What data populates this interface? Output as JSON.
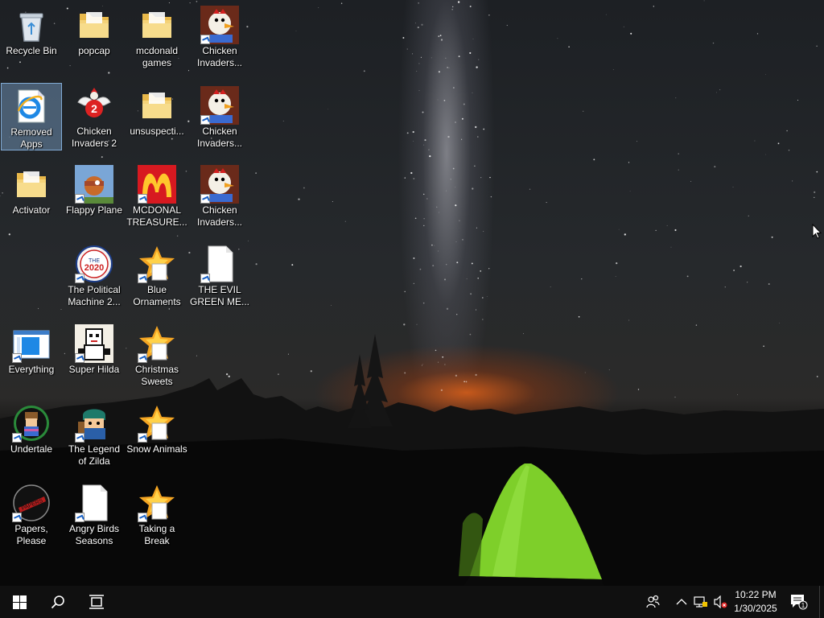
{
  "desktop_icons": [
    {
      "id": "recycle-bin",
      "label": "Recycle Bin",
      "icon": "recycle-bin-icon",
      "shortcut": false,
      "selected": false
    },
    {
      "id": "popcap",
      "label": "popcap",
      "icon": "folder-icon",
      "shortcut": false,
      "selected": false
    },
    {
      "id": "mcdonald-games",
      "label": "mcdonald games",
      "icon": "folder-icon",
      "shortcut": false,
      "selected": false
    },
    {
      "id": "chicken-invaders-1",
      "label": "Chicken Invaders...",
      "icon": "chicken-invaders-icon",
      "shortcut": true,
      "selected": false
    },
    {
      "id": "removed-apps",
      "label": "Removed Apps",
      "icon": "internet-explorer-icon",
      "shortcut": false,
      "selected": true
    },
    {
      "id": "chicken-invaders-2",
      "label": "Chicken Invaders 2",
      "icon": "chicken-invaders-2-icon",
      "shortcut": false,
      "selected": false
    },
    {
      "id": "unsuspecting",
      "label": "unsuspecti...",
      "icon": "folder-icon",
      "shortcut": false,
      "selected": false
    },
    {
      "id": "chicken-invaders-3",
      "label": "Chicken Invaders...",
      "icon": "chicken-invaders-icon",
      "shortcut": true,
      "selected": false
    },
    {
      "id": "activator",
      "label": "Activator",
      "icon": "folder-icon",
      "shortcut": false,
      "selected": false
    },
    {
      "id": "flappy-plane",
      "label": "Flappy Plane",
      "icon": "flappy-plane-icon",
      "shortcut": true,
      "selected": false
    },
    {
      "id": "mcdonal-treasure",
      "label": "MCDONAL TREASURE...",
      "icon": "mcdonalds-icon",
      "shortcut": true,
      "selected": false
    },
    {
      "id": "chicken-invaders-4",
      "label": "Chicken Invaders...",
      "icon": "chicken-invaders-icon",
      "shortcut": true,
      "selected": false
    },
    {
      "id": "political-machine",
      "label": "The Political Machine 2...",
      "icon": "political-machine-icon",
      "shortcut": true,
      "selected": false
    },
    {
      "id": "blue-ornaments",
      "label": "Blue Ornaments",
      "icon": "star-game-icon",
      "shortcut": true,
      "selected": false
    },
    {
      "id": "evil-green-me",
      "label": "THE EVIL GREEN ME...",
      "icon": "blank-file-icon",
      "shortcut": true,
      "selected": false
    },
    {
      "id": "everything",
      "label": "Everything",
      "icon": "everything-search-icon",
      "shortcut": true,
      "selected": false
    },
    {
      "id": "super-hilda",
      "label": "Super Hilda",
      "icon": "super-hilda-icon",
      "shortcut": true,
      "selected": false
    },
    {
      "id": "christmas-sweets",
      "label": "Christmas Sweets",
      "icon": "star-game-icon",
      "shortcut": true,
      "selected": false
    },
    {
      "id": "undertale",
      "label": "Undertale",
      "icon": "undertale-icon",
      "shortcut": true,
      "selected": false
    },
    {
      "id": "legend-of-zilda",
      "label": "The Legend of Zilda",
      "icon": "legend-of-zilda-icon",
      "shortcut": true,
      "selected": false
    },
    {
      "id": "snow-animals",
      "label": "Snow Animals",
      "icon": "star-game-icon",
      "shortcut": true,
      "selected": false
    },
    {
      "id": "papers-please",
      "label": "Papers, Please",
      "icon": "papers-please-icon",
      "shortcut": true,
      "selected": false
    },
    {
      "id": "angry-birds-seasons",
      "label": "Angry Birds Seasons",
      "icon": "blank-file-icon",
      "shortcut": true,
      "selected": false
    },
    {
      "id": "taking-a-break",
      "label": "Taking a Break",
      "icon": "star-game-icon",
      "shortcut": true,
      "selected": false
    }
  ],
  "taskbar": {
    "start_icon": "windows-logo-icon",
    "search_icon": "search-icon",
    "task_view_icon": "task-view-icon",
    "tray": {
      "people_icon": "people-icon",
      "show_hidden_icon": "chevron-up-icon",
      "network_icon": "network-icon",
      "volume_icon": "volume-muted-icon",
      "time": "10:22 PM",
      "date": "1/30/2025",
      "notification_icon": "action-center-icon",
      "notification_count": "1"
    }
  },
  "colors": {
    "taskbar": "#101010",
    "selection": "#99ccff",
    "tent": "#7ecf2a"
  }
}
